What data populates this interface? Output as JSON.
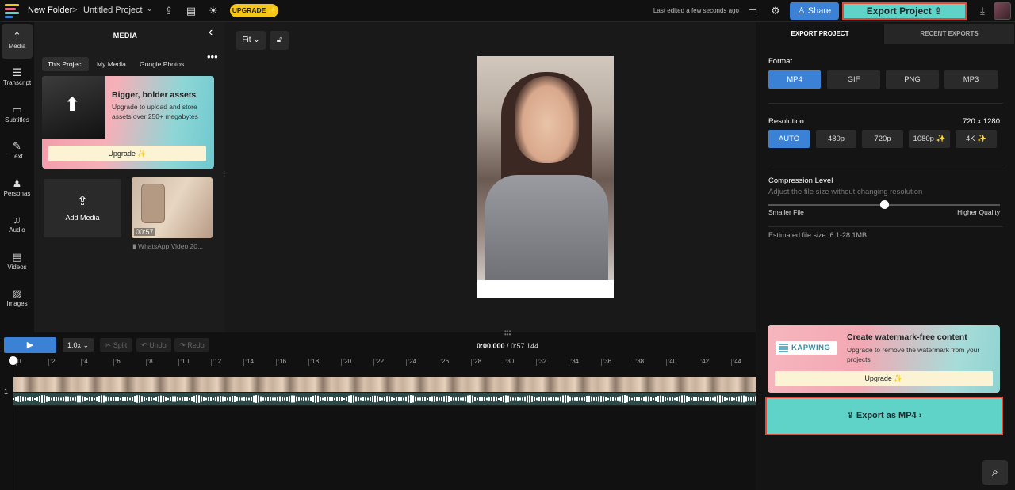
{
  "topbar": {
    "folder": "New Folder",
    "separator": ">",
    "project": "Untitled Project",
    "project_chevron": "⌄",
    "upgrade": "UPGRADE ✨",
    "last_edited": "Last edited a few seconds ago",
    "share": "Share",
    "export_project": "Export Project",
    "icons": [
      "share-upload-icon",
      "subtitles-icon",
      "lightbulb-icon",
      "comment-icon",
      "gear-icon",
      "download-icon"
    ]
  },
  "rail": {
    "items": [
      {
        "label": "Media",
        "icon": "upload-icon",
        "glyph": "⇡"
      },
      {
        "label": "Transcript",
        "icon": "transcript-icon",
        "glyph": "☰"
      },
      {
        "label": "Subtitles",
        "icon": "subtitles-icon",
        "glyph": "▭"
      },
      {
        "label": "Text",
        "icon": "text-icon",
        "glyph": "✎"
      },
      {
        "label": "Personas",
        "icon": "person-icon",
        "glyph": "♟"
      },
      {
        "label": "Audio",
        "icon": "music-icon",
        "glyph": "♫"
      },
      {
        "label": "Videos",
        "icon": "film-icon",
        "glyph": "▤"
      },
      {
        "label": "Images",
        "icon": "image-icon",
        "glyph": "▨"
      }
    ]
  },
  "media_panel": {
    "title": "MEDIA",
    "tabs": [
      "This Project",
      "My Media",
      "Google Photos"
    ],
    "promo": {
      "title": "Bigger, bolder assets",
      "text": "Upgrade to upload and store assets over 250+ megabytes",
      "button": "Upgrade ✨"
    },
    "add_media": "Add Media",
    "clip": {
      "duration": "00:57",
      "name": "WhatsApp Video 20..."
    }
  },
  "canvas": {
    "fit": "Fit"
  },
  "export_panel": {
    "tabs": [
      "EXPORT PROJECT",
      "RECENT EXPORTS"
    ],
    "format_label": "Format",
    "formats": [
      "MP4",
      "GIF",
      "PNG",
      "MP3"
    ],
    "resolution_label": "Resolution:",
    "resolution_value": "720 x 1280",
    "resolutions": [
      "AUTO",
      "480p",
      "720p",
      "1080p ✨",
      "4K ✨"
    ],
    "compression_label": "Compression Level",
    "compression_sub": "Adjust the file size without changing resolution",
    "compression_level": 0.5,
    "slider_min_label": "Smaller File",
    "slider_max_label": "Higher Quality",
    "estimate": "Estimated file size: 6.1-28.1MB",
    "watermark": {
      "brand": "KAPWING",
      "title": "Create watermark-free content",
      "text": "Upgrade to remove the watermark from your projects",
      "button": "Upgrade ✨"
    },
    "export_button": "Export as MP4"
  },
  "timeline": {
    "speed": "1.0x",
    "split": "✂ Split",
    "undo": "↶ Undo",
    "redo": "↷ Redo",
    "current_time": "0:00.000",
    "total_time": "/ 0:57.144",
    "ticks": [
      "0",
      ":2",
      ":4",
      ":6",
      ":8",
      ":10",
      ":12",
      ":14",
      ":16",
      ":18",
      ":20",
      ":22",
      ":24",
      ":26",
      ":28",
      ":30",
      ":32",
      ":34",
      ":36",
      ":38",
      ":40",
      ":42",
      ":44"
    ],
    "track_number": "1"
  },
  "colors": {
    "accent": "#3b82d6",
    "export": "#5fd3c8",
    "highlight": "#e04a3a",
    "upgrade": "#f5c518"
  }
}
